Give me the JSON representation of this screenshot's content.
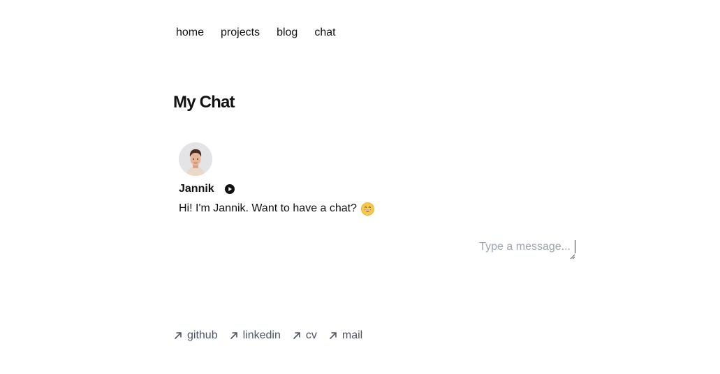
{
  "nav": {
    "items": [
      {
        "label": "home"
      },
      {
        "label": "projects"
      },
      {
        "label": "blog"
      },
      {
        "label": "chat"
      }
    ]
  },
  "page": {
    "title": "My Chat"
  },
  "chat": {
    "message": {
      "author": "Jannik",
      "text": "Hi! I'm Jannik. Want to have a chat?",
      "emoji": "grinning-face-emoji"
    },
    "composer": {
      "placeholder": "Type a message...",
      "value": ""
    }
  },
  "footer": {
    "links": [
      {
        "label": "github",
        "icon": "arrow-up-right-icon"
      },
      {
        "label": "linkedin",
        "icon": "arrow-up-right-icon"
      },
      {
        "label": "cv",
        "icon": "arrow-up-right-icon"
      },
      {
        "label": "mail",
        "icon": "arrow-up-right-icon"
      }
    ]
  },
  "colors": {
    "text": "#111111",
    "muted": "#4b5563",
    "placeholder": "#9ca3af",
    "avatar_bg": "#e4e4e7"
  }
}
